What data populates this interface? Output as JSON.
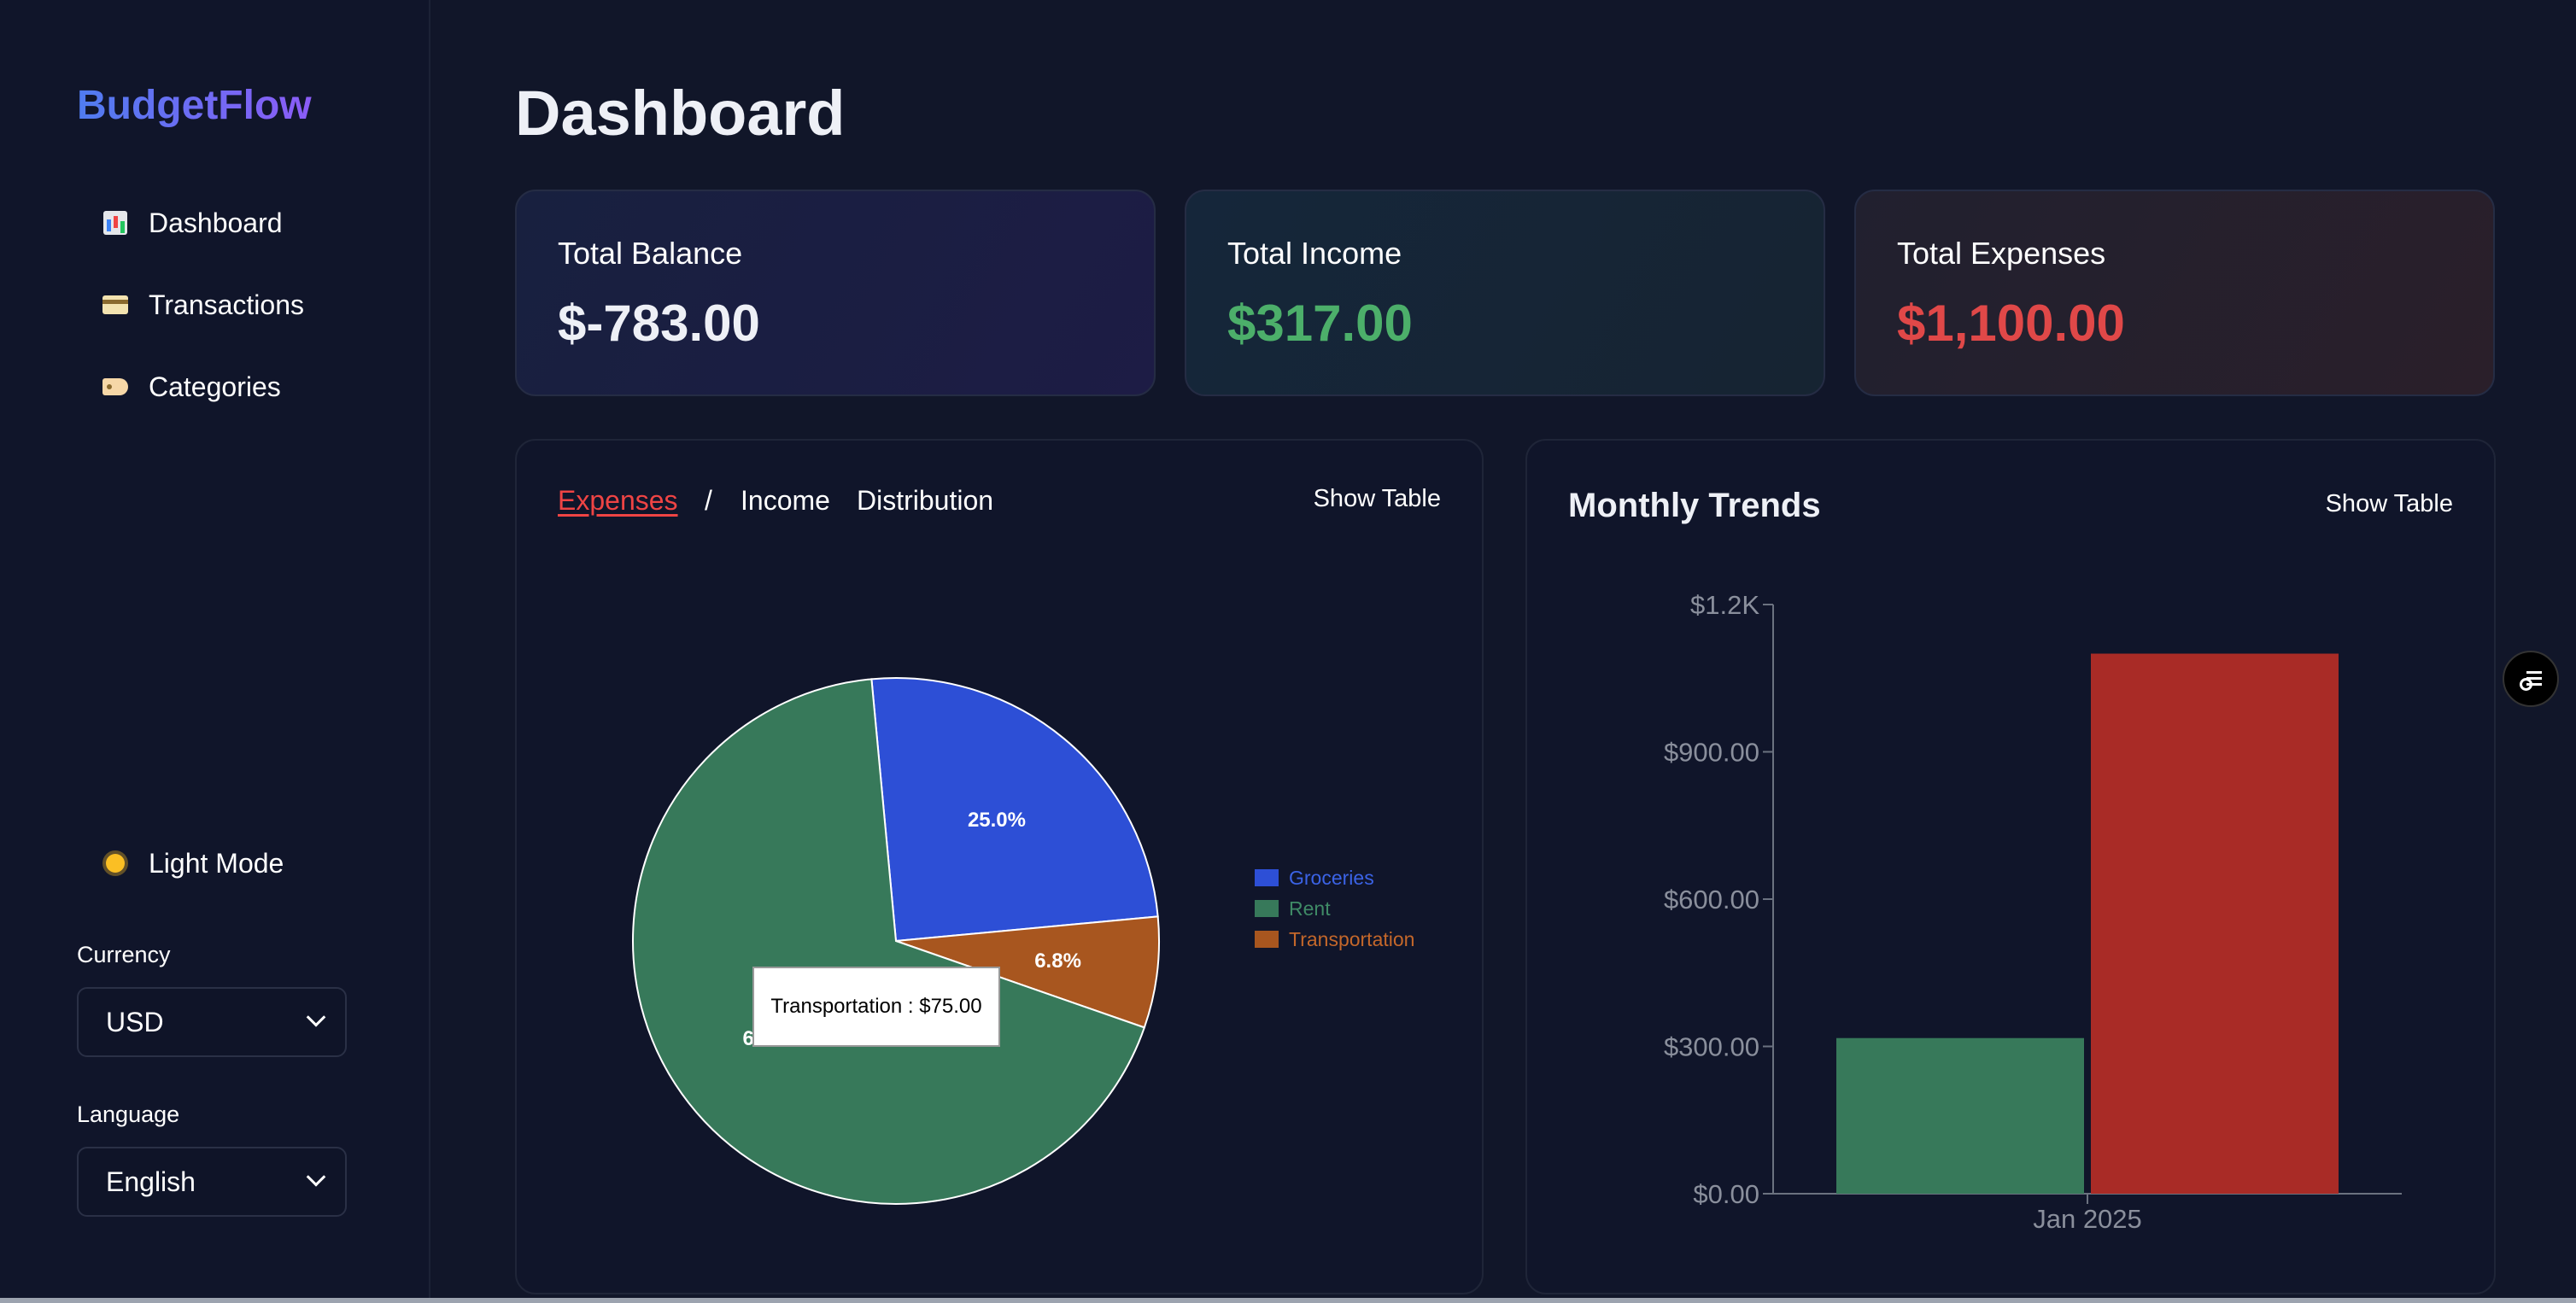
{
  "app": {
    "logo": "BudgetFlow"
  },
  "sidebar": {
    "nav": [
      {
        "label": "Dashboard",
        "icon": "bar-chart-icon"
      },
      {
        "label": "Transactions",
        "icon": "credit-card-icon"
      },
      {
        "label": "Categories",
        "icon": "tag-icon"
      }
    ],
    "theme_toggle": {
      "label": "Light Mode",
      "icon": "sun-icon"
    },
    "currency": {
      "label": "Currency",
      "value": "USD"
    },
    "language": {
      "label": "Language",
      "value": "English"
    }
  },
  "page": {
    "title": "Dashboard"
  },
  "stats": {
    "balance": {
      "label": "Total Balance",
      "value": "$-783.00"
    },
    "income": {
      "label": "Total Income",
      "value": "$317.00",
      "color": "#4caf6a"
    },
    "expenses": {
      "label": "Total Expenses",
      "value": "$1,100.00",
      "color": "#e04848"
    }
  },
  "distribution": {
    "tab_expenses": "Expenses",
    "separator": "/",
    "tab_income": "Income",
    "title_suffix": "Distribution",
    "show_table": "Show Table",
    "tooltip": "Transportation : $75.00",
    "slice_labels": [
      "25.0%",
      "68.2%",
      "6.8%"
    ]
  },
  "trends": {
    "title": "Monthly Trends",
    "show_table": "Show Table"
  },
  "chart_data": [
    {
      "type": "pie",
      "categories": [
        "Groceries",
        "Rent",
        "Transportation"
      ],
      "values": [
        275,
        750,
        75
      ],
      "colors": [
        "#2d4fd6",
        "#37795a",
        "#a8561f"
      ],
      "percent_labels": [
        "25.0%",
        "68.2%",
        "6.8%"
      ],
      "legend": "right"
    },
    {
      "type": "bar",
      "categories": [
        "Jan 2025"
      ],
      "series": [
        {
          "values": [
            317
          ],
          "color": "#37795a"
        },
        {
          "values": [
            1100
          ],
          "color": "#a92b26"
        }
      ],
      "ylim": [
        0,
        1200
      ],
      "yticks": [
        "$0.00",
        "$300.00",
        "$600.00",
        "$900.00",
        "$1.2K"
      ],
      "ytick_values": [
        0,
        300,
        600,
        900,
        1200
      ]
    }
  ]
}
